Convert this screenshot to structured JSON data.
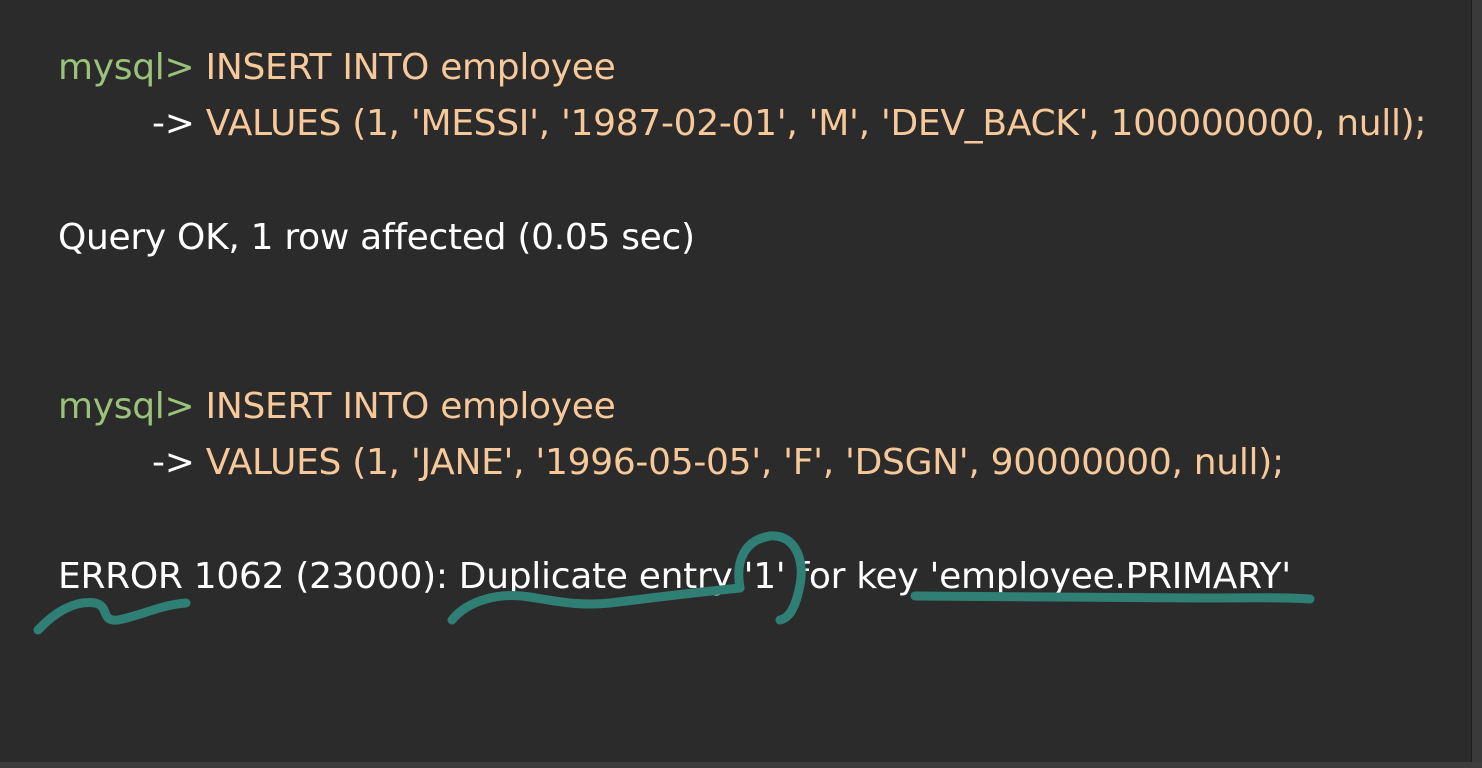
{
  "terminal": {
    "block1": {
      "prompt": "mysql>",
      "statement": " INSERT INTO employee",
      "continuation_marker": "->",
      "values_line": " VALUES (1, 'MESSI', '1987-02-01', 'M', 'DEV_BACK', 100000000, null);",
      "result": "Query OK, 1 row affected (0.05 sec)"
    },
    "block2": {
      "prompt": "mysql>",
      "statement": " INSERT INTO employee",
      "continuation_marker": "->",
      "values_line": " VALUES (1, 'JANE', '1996-05-05', 'F', 'DSGN', 90000000, null);",
      "error": "ERROR 1062 (23000): Duplicate entry '1' for key 'employee.PRIMARY'"
    }
  },
  "colors": {
    "background": "#2b2b2b",
    "prompt": "#9bc27a",
    "sql_text": "#f7c99a",
    "output_text": "#ffffff",
    "annotation_ink": "#2f7f74"
  }
}
